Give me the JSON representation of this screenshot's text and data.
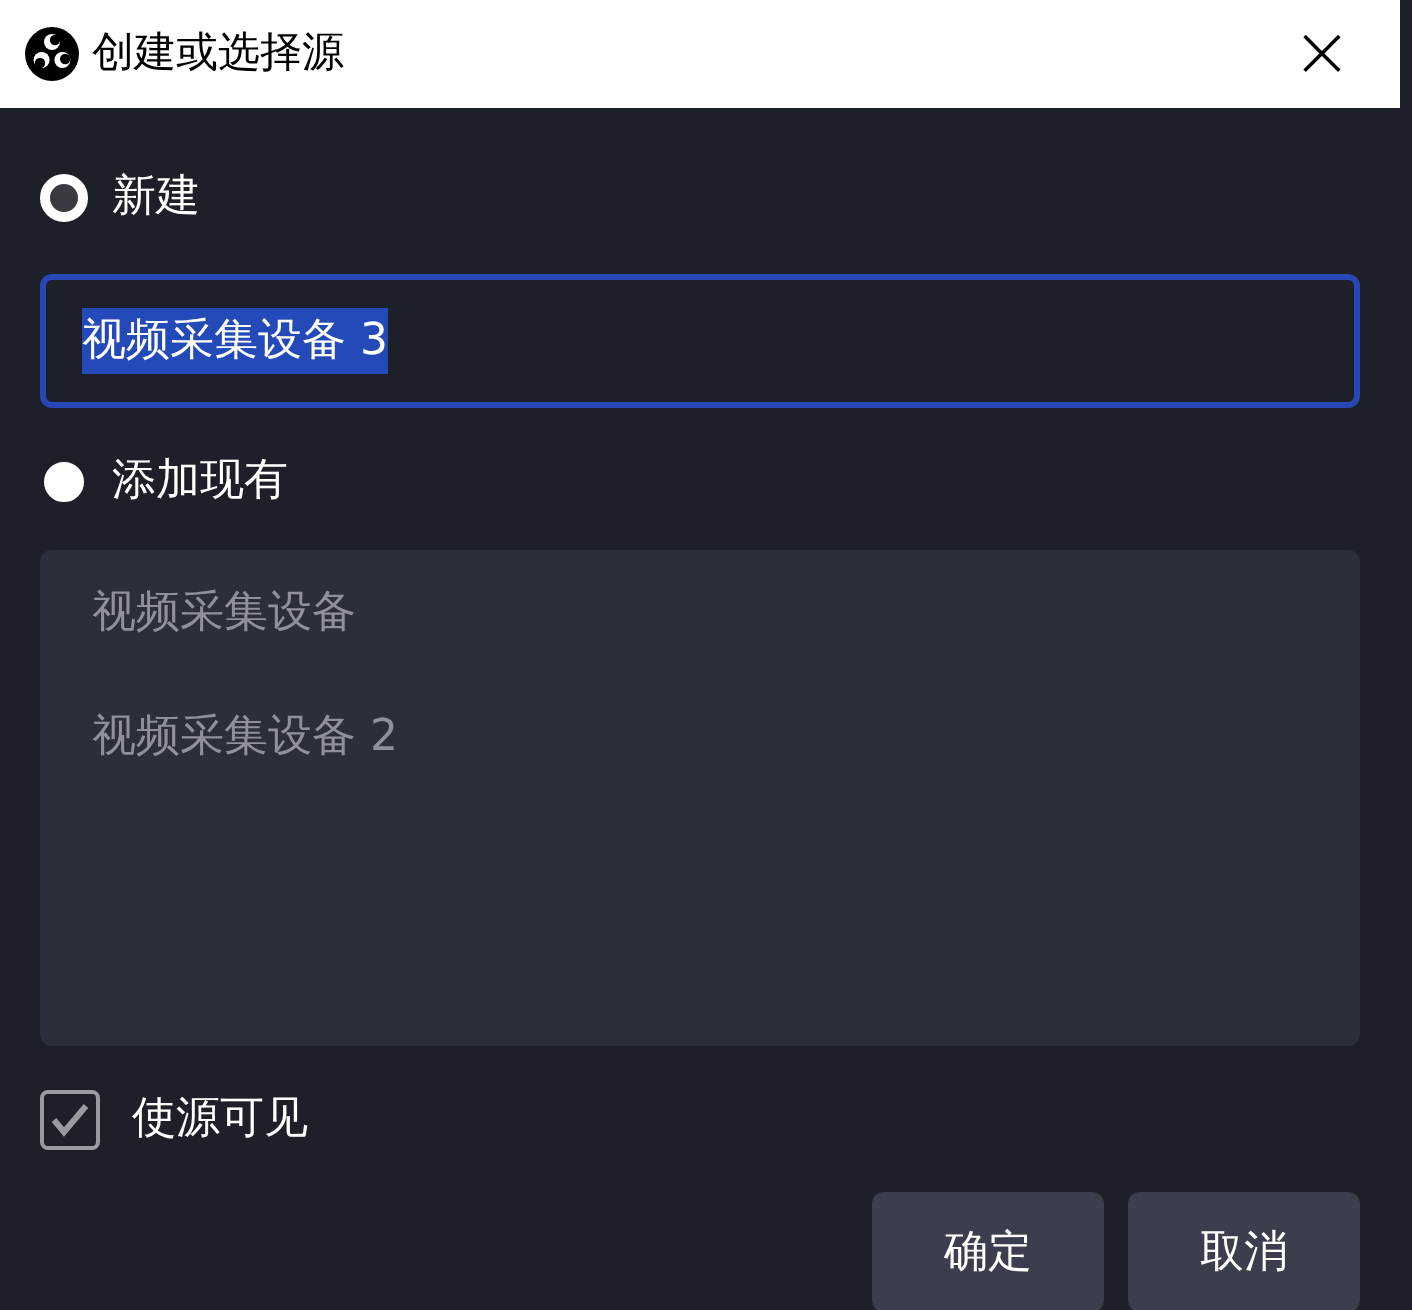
{
  "window": {
    "title": "创建或选择源",
    "close": "×"
  },
  "options": [
    {
      "label": "新建",
      "selected": true
    },
    {
      "label": "添加现有",
      "selected": false
    }
  ],
  "name_field": {
    "value": "视频采集设备 3",
    "text_selected": true,
    "focused": true
  },
  "existing_sources": [
    "视频采集设备",
    "视频采集设备 2"
  ],
  "visible_checkbox": {
    "label": "使源可见",
    "checked": true
  },
  "buttons": [
    "确定",
    "取消"
  ]
}
